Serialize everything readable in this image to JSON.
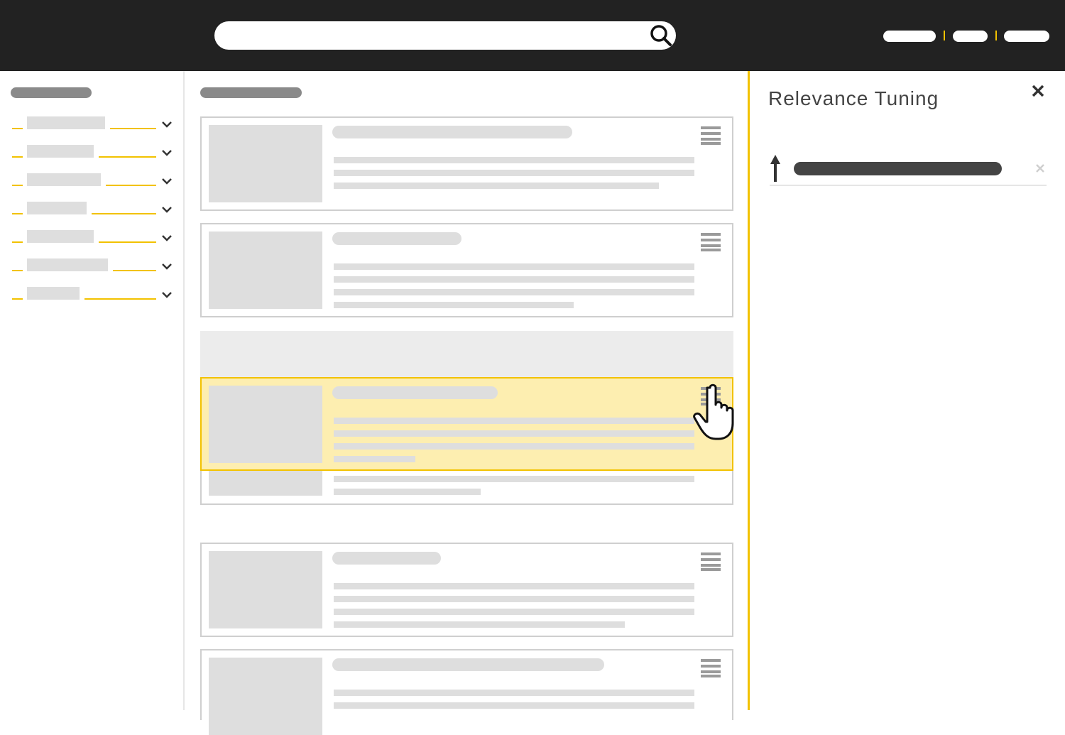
{
  "colors": {
    "topbar": "#222222",
    "accent": "#f2c200",
    "highlight": "#fdeeb0",
    "placeholder": "#dedede",
    "heading_placeholder": "#8a8a8a",
    "rule_bar": "#444444"
  },
  "topbar": {
    "search": {
      "value": "",
      "icon": "search-icon"
    },
    "nav_items": 3
  },
  "sidebar": {
    "facets": [
      "facet",
      "facet",
      "facet",
      "facet",
      "facet",
      "facet",
      "facet"
    ]
  },
  "results": {
    "cards": 5,
    "highlighted_card": 3,
    "card_menu_icon": "hamburger-icon"
  },
  "panel": {
    "title": "Relevance Tuning",
    "close_icon": "close-icon",
    "rules": [
      {
        "direction_icon": "boost-up-arrow-icon",
        "remove_icon": "remove-icon"
      }
    ]
  }
}
